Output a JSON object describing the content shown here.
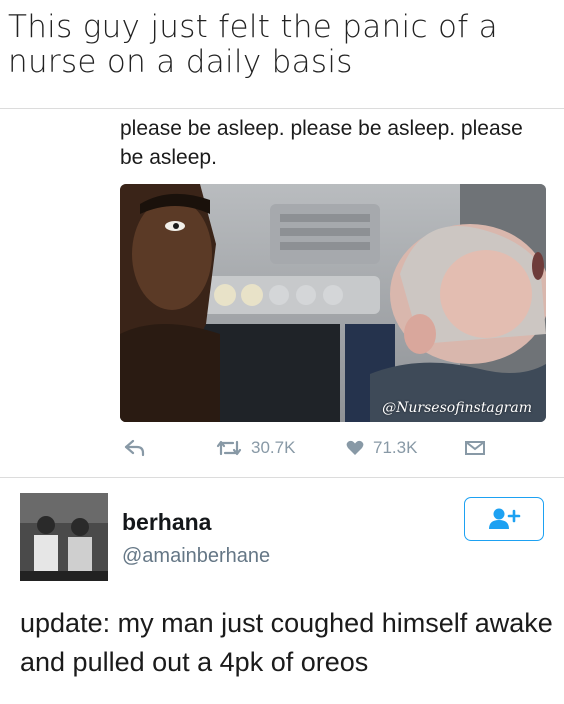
{
  "meme": {
    "caption": "This guy just felt the panic of a nurse on a daily basis"
  },
  "tweet1": {
    "text": "please be asleep. please be asleep. please be asleep.",
    "photo_watermark": "@Nursesofinstagram",
    "retweets": "30.7K",
    "likes": "71.3K",
    "icons": [
      "reply-icon",
      "retweet-icon",
      "heart-icon",
      "mail-icon"
    ]
  },
  "tweet2": {
    "display_name": "berhana",
    "handle": "@amainberhane",
    "text": "update: my man just coughed himself awake and pulled out a 4pk of oreos",
    "icons": [
      "add-user-icon"
    ]
  },
  "colors": {
    "accent": "#1da1f2",
    "muted": "#8899a6",
    "text": "#14171a"
  }
}
